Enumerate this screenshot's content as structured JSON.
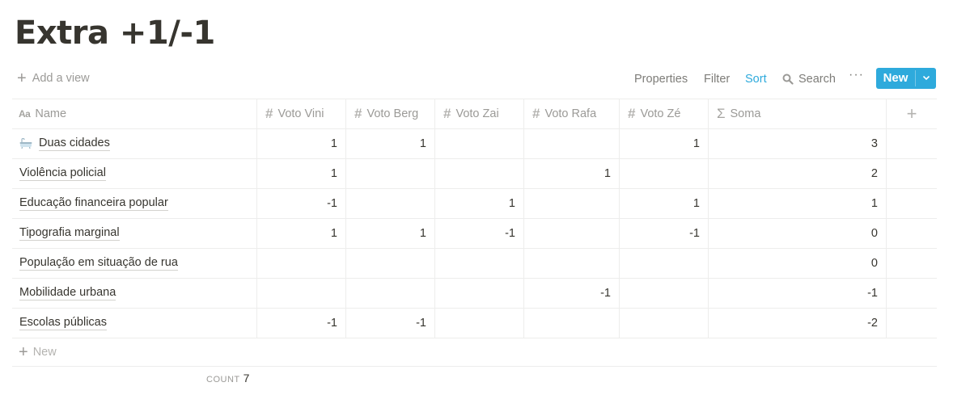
{
  "page": {
    "title": "Extra +1/-1"
  },
  "toolbar": {
    "add_view": "Add a view",
    "properties": "Properties",
    "filter": "Filter",
    "sort": "Sort",
    "search": "Search",
    "more": "···",
    "new": "New"
  },
  "columns": [
    "Name",
    "Voto Vini",
    "Voto Berg",
    "Voto Zai",
    "Voto Rafa",
    "Voto Zé",
    "Soma"
  ],
  "rows": [
    {
      "name": "Duas cidades",
      "icon": "bathtub-icon",
      "votes": [
        "1",
        "1",
        "",
        "",
        "1"
      ],
      "soma": "3"
    },
    {
      "name": "Violência policial",
      "votes": [
        "1",
        "",
        "",
        "1",
        ""
      ],
      "soma": "2"
    },
    {
      "name": "Educação financeira popular",
      "votes": [
        "-1",
        "",
        "1",
        "",
        "1"
      ],
      "soma": "1"
    },
    {
      "name": "Tipografia marginal",
      "votes": [
        "1",
        "1",
        "-1",
        "",
        "-1"
      ],
      "soma": "0"
    },
    {
      "name": "População em situação de rua",
      "votes": [
        "",
        "",
        "",
        "",
        ""
      ],
      "soma": "0"
    },
    {
      "name": "Mobilidade urbana",
      "votes": [
        "",
        "",
        "",
        "-1",
        ""
      ],
      "soma": "-1"
    },
    {
      "name": "Escolas públicas",
      "votes": [
        "-1",
        "-1",
        "",
        "",
        ""
      ],
      "soma": "-2"
    }
  ],
  "new_row": "New",
  "footer": {
    "count_label": "COUNT",
    "count_value": "7"
  },
  "colors": {
    "accent": "#2eaadc",
    "text": "#37352f",
    "muted": "#9b9a97"
  }
}
